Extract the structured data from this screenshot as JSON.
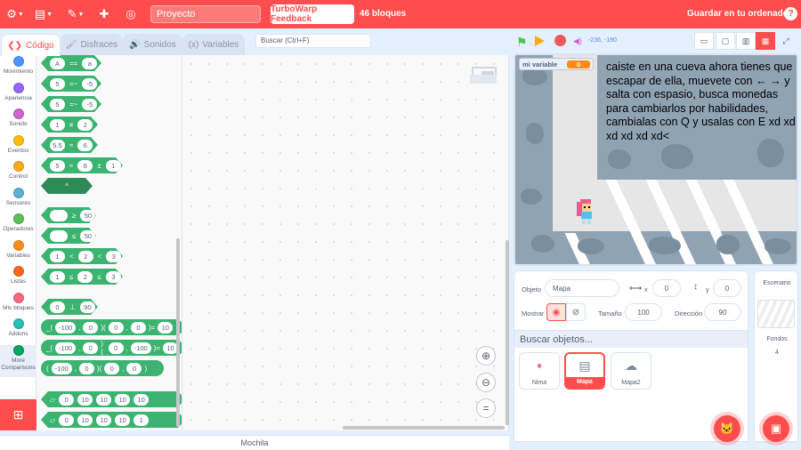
{
  "menu": {
    "project_title": "Proyecto",
    "feedback_label": "TurboWarp Feedback",
    "block_count": "46 bloques",
    "save_label": "Guardar en tu ordenador",
    "help": "?"
  },
  "tabs": [
    {
      "label": "Código",
      "icon": "code-icon"
    },
    {
      "label": "Disfraces",
      "icon": "brush-icon"
    },
    {
      "label": "Sonidos",
      "icon": "speaker-icon"
    },
    {
      "label": "Variables",
      "icon": "braces-icon"
    }
  ],
  "search": {
    "value": "Buscar (Ctrl+F)"
  },
  "categories": [
    {
      "label": "Movimiento",
      "color": "#4c97ff"
    },
    {
      "label": "Apariencia",
      "color": "#9966ff"
    },
    {
      "label": "Sonido",
      "color": "#cf63cf"
    },
    {
      "label": "Eventos",
      "color": "#ffbf00"
    },
    {
      "label": "Control",
      "color": "#ffab19"
    },
    {
      "label": "Sensores",
      "color": "#5cb1d6"
    },
    {
      "label": "Operadores",
      "color": "#59c059"
    },
    {
      "label": "Variables",
      "color": "#ff8c1a"
    },
    {
      "label": "Listas",
      "color": "#ff661a"
    },
    {
      "label": "Mis bloques",
      "color": "#ff6680"
    },
    {
      "label": "Addons",
      "color": "#29beb8"
    },
    {
      "label": "More Comparisons",
      "color": "#00a65c"
    }
  ],
  "palette": {
    "b1": [
      "A",
      "==",
      "a"
    ],
    "b2": [
      "5",
      "=~",
      "-5"
    ],
    "b3": [
      "5",
      "=~",
      "-5"
    ],
    "b4": [
      "1",
      "≠",
      "2"
    ],
    "b5": [
      "5.5",
      "≈",
      "6"
    ],
    "b6": [
      "5",
      "≈",
      "6",
      "±",
      "1"
    ],
    "b7": [
      "^"
    ],
    "b8": [
      "≥",
      "50"
    ],
    "b9": [
      "≤",
      "50"
    ],
    "b10": [
      "1",
      "<",
      "2",
      "<",
      "3"
    ],
    "b11": [
      "1",
      "≤",
      "2",
      "≤",
      "3"
    ],
    "b12": [
      "0",
      "⊥",
      "90"
    ],
    "b13": [
      "_(",
      "-100",
      ",",
      "0",
      ")(",
      "0",
      ",",
      "0",
      ")=",
      "10"
    ],
    "b14": [
      "_(",
      "-100",
      ",",
      "0",
      ")(",
      "0",
      ",",
      "-100",
      ")=",
      "10"
    ],
    "b15": [
      "(",
      "-100",
      ",",
      "0",
      ")(",
      "0",
      ",",
      "0",
      ")"
    ],
    "b16": [
      "0",
      "10",
      "10",
      "10",
      "10"
    ],
    "b17": [
      "0",
      "10",
      "10",
      "10",
      "1"
    ]
  },
  "stage": {
    "coords": "-236, -180",
    "variable_name": "mi variable",
    "variable_value": "0",
    "say_text": "caiste en una cueva ahora tienes que escapar de ella, muevete con ← → y salta con espasio, busca monedas para cambiarlos por habilidades, cambialas con Q y usalas con E xd xd xd xd xd xd<"
  },
  "sprite_info": {
    "sprite_label": "Objeto",
    "sprite_name": "Mapa",
    "x_label": "x",
    "x_value": "0",
    "y_label": "y",
    "y_value": "0",
    "show_label": "Mostrar",
    "size_label": "Tamaño",
    "size_value": "100",
    "direction_label": "Dirección",
    "direction_value": "90",
    "search_placeholder": "Buscar objetos..."
  },
  "sprites": [
    {
      "name": "Nima"
    },
    {
      "name": "Mapa"
    },
    {
      "name": "Mapa2"
    }
  ],
  "stage_panel": {
    "title": "Escenario",
    "backdrops_label": "Fondos",
    "backdrops_count": "4"
  },
  "backpack": "Mochila"
}
